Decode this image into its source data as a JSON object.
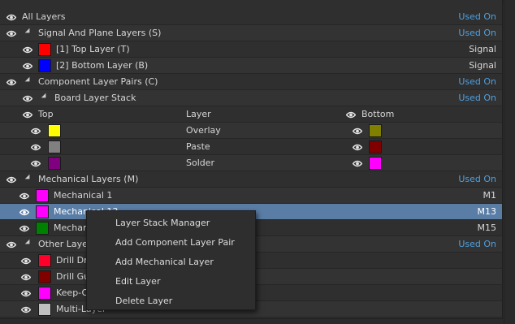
{
  "header": {
    "title": "All Layers",
    "used_on": "Used On"
  },
  "signal_group": {
    "title": "Signal And Plane Layers (S)",
    "used_on": "Used On",
    "items": [
      {
        "label": "[1] Top Layer (T)",
        "color": "#ff0000",
        "used": "Signal"
      },
      {
        "label": "[2] Bottom Layer (B)",
        "color": "#0000ff",
        "used": "Signal"
      }
    ]
  },
  "component_group": {
    "title": "Component Layer Pairs (C)",
    "used_on": "Used On",
    "stack": {
      "title": "Board Layer Stack",
      "used_on": "Used On",
      "columns": {
        "top": "Top",
        "layer": "Layer",
        "bottom": "Bottom"
      },
      "pairs": [
        {
          "layer": "Overlay",
          "top_color": "#ffff00",
          "bottom_color": "#808000"
        },
        {
          "layer": "Paste",
          "top_color": "#808080",
          "bottom_color": "#800000"
        },
        {
          "layer": "Solder",
          "top_color": "#800080",
          "bottom_color": "#ff00ff"
        }
      ]
    }
  },
  "mechanical_group": {
    "title": "Mechanical Layers (M)",
    "used_on": "Used On",
    "items": [
      {
        "label": "Mechanical 1",
        "color": "#ff00ff",
        "used": "M1"
      },
      {
        "label": "Mechanical 13",
        "color": "#ff00ff",
        "used": "M13",
        "selected": true
      },
      {
        "label": "Mechanical 15",
        "color": "#008000",
        "used": "M15"
      }
    ]
  },
  "other_group": {
    "title": "Other Layers",
    "used_on": "Used On",
    "items": [
      {
        "label": "Drill Drawing",
        "color": "#ff002a"
      },
      {
        "label": "Drill Guide",
        "color": "#800000"
      },
      {
        "label": "Keep-Out Layer",
        "color": "#ff00ff"
      },
      {
        "label": "Multi-Layer",
        "color": "#c0c0c0"
      }
    ]
  },
  "context_menu": {
    "items": [
      "Layer Stack Manager",
      "Add Component Layer Pair",
      "Add Mechanical Layer",
      "Edit Layer",
      "Delete Layer"
    ]
  },
  "colors": {
    "accent_link": "#4fa0e0",
    "selection": "#5a7da6"
  }
}
